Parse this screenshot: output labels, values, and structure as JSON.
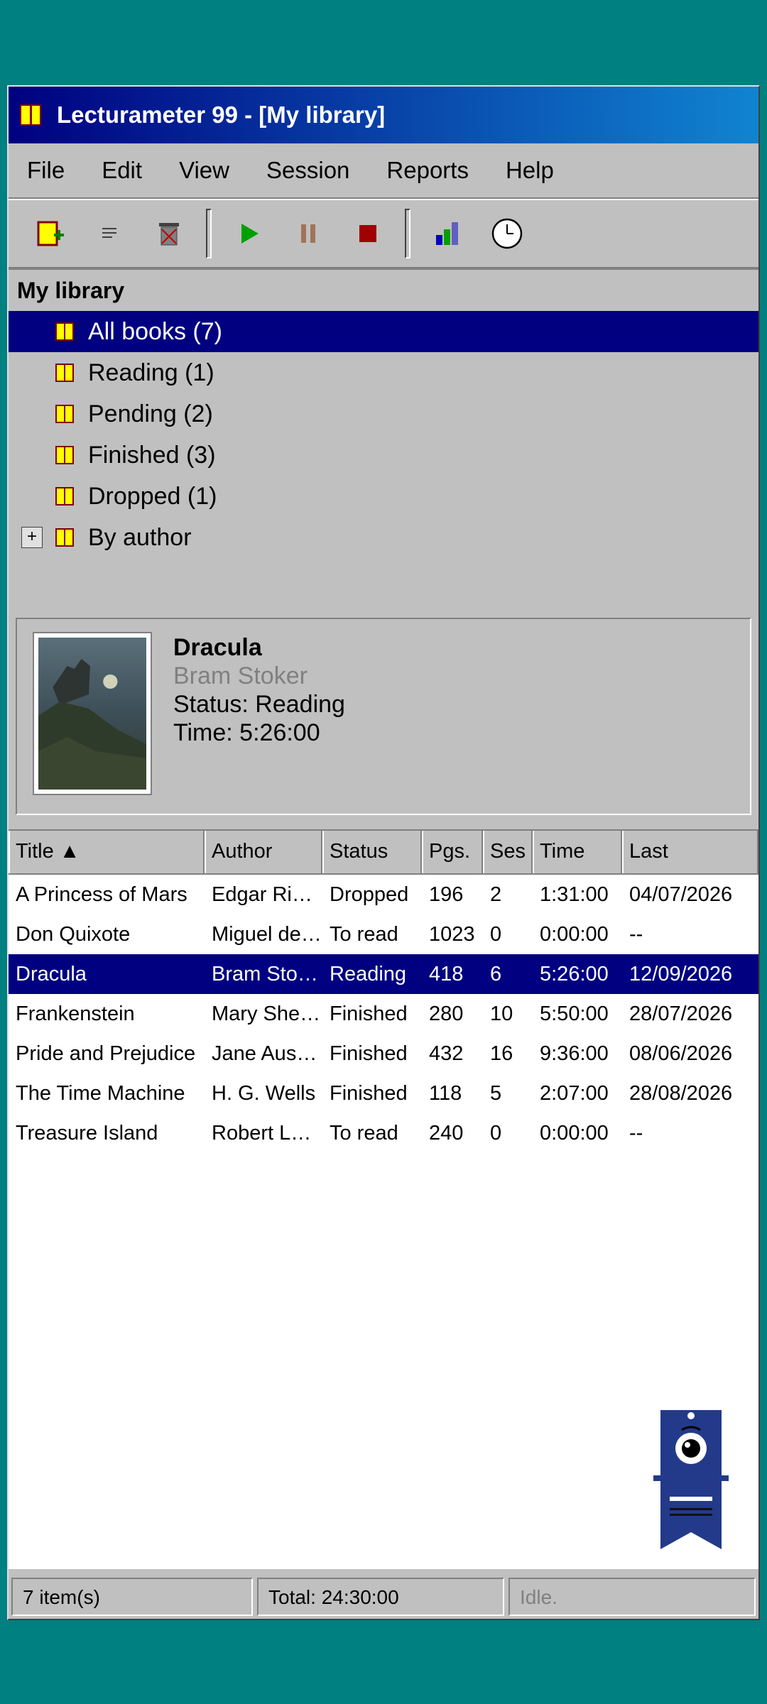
{
  "window": {
    "title": "Lecturameter 99 - [My library]"
  },
  "menu": [
    "File",
    "Edit",
    "View",
    "Session",
    "Reports",
    "Help"
  ],
  "toolbar": {
    "icons": [
      "new-book-icon",
      "list-icon",
      "delete-icon",
      "play-icon",
      "pause-icon",
      "stop-icon",
      "chart-icon",
      "clock-icon"
    ]
  },
  "tree": {
    "root": "My library",
    "items": [
      {
        "label": "All books (7)",
        "selected": true
      },
      {
        "label": "Reading (1)"
      },
      {
        "label": "Pending (2)"
      },
      {
        "label": "Finished (3)"
      },
      {
        "label": "Dropped (1)"
      },
      {
        "label": "By author",
        "expander": "+"
      }
    ]
  },
  "details": {
    "title": "Dracula",
    "author": "Bram Stoker",
    "status": "Status: Reading",
    "time": "Time: 5:26:00"
  },
  "list": {
    "columns": [
      "Title ▲",
      "Author",
      "Status",
      "Pgs.",
      "Ses",
      "Time",
      "Last"
    ],
    "rows": [
      [
        "A Princess of Mars",
        "Edgar Rice Burroughs",
        "Dropped",
        "196",
        "2",
        "1:31:00",
        "04/07/2026"
      ],
      [
        "Don Quixote",
        "Miguel de Cervantes",
        "To read",
        "1023",
        "0",
        "0:00:00",
        "--"
      ],
      [
        "Dracula",
        "Bram Stoker",
        "Reading",
        "418",
        "6",
        "5:26:00",
        "12/09/2026"
      ],
      [
        "Frankenstein",
        "Mary Shelley",
        "Finished",
        "280",
        "10",
        "5:50:00",
        "28/07/2026"
      ],
      [
        "Pride and Prejudice",
        "Jane Austen",
        "Finished",
        "432",
        "16",
        "9:36:00",
        "08/06/2026"
      ],
      [
        "The Time Machine",
        "H. G. Wells",
        "Finished",
        "118",
        "5",
        "2:07:00",
        "28/08/2026"
      ],
      [
        "Treasure Island",
        "Robert Louis Stevenson",
        "To read",
        "240",
        "0",
        "0:00:00",
        "--"
      ]
    ],
    "selected_index": 2
  },
  "status": {
    "items": "7 item(s)",
    "total": "Total: 24:30:00",
    "state": "Idle."
  },
  "colors": {
    "desktop": "#008080",
    "selection": "#000080",
    "face": "#c0c0c0"
  }
}
